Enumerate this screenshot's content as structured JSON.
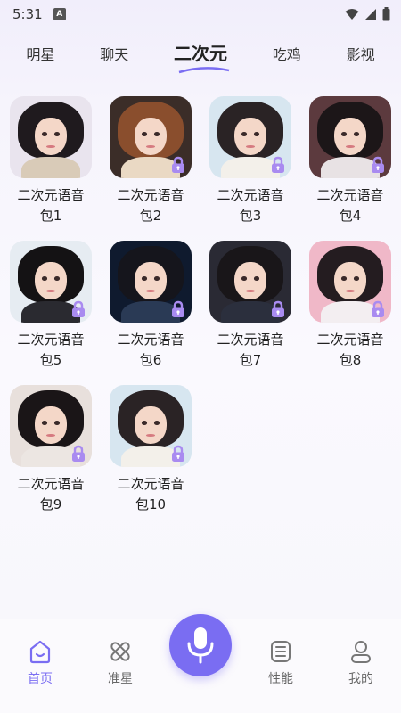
{
  "status_bar": {
    "time": "5:31",
    "app_icon_letter": "A",
    "icons": [
      "wifi-icon",
      "signal-icon",
      "battery-icon"
    ]
  },
  "tabs": [
    {
      "label": "明星",
      "active": false
    },
    {
      "label": "聊天",
      "active": false
    },
    {
      "label": "二次元",
      "active": true
    },
    {
      "label": "吃鸡",
      "active": false
    },
    {
      "label": "影视",
      "active": false
    }
  ],
  "voice_packs": [
    {
      "line1": "二次元语音",
      "line2": "包1",
      "locked": false
    },
    {
      "line1": "二次元语音",
      "line2": "包2",
      "locked": true
    },
    {
      "line1": "二次元语音",
      "line2": "包3",
      "locked": true
    },
    {
      "line1": "二次元语音",
      "line2": "包4",
      "locked": true
    },
    {
      "line1": "二次元语音",
      "line2": "包5",
      "locked": true
    },
    {
      "line1": "二次元语音",
      "line2": "包6",
      "locked": true
    },
    {
      "line1": "二次元语音",
      "line2": "包7",
      "locked": true
    },
    {
      "line1": "二次元语音",
      "line2": "包8",
      "locked": true
    },
    {
      "line1": "二次元语音",
      "line2": "包9",
      "locked": true
    },
    {
      "line1": "二次元语音",
      "line2": "包10",
      "locked": true
    }
  ],
  "bottom_nav": {
    "items": [
      {
        "label": "首页",
        "icon": "home-icon",
        "active": true
      },
      {
        "label": "准星",
        "icon": "crosshair-icon",
        "active": false
      },
      {
        "label": "性能",
        "icon": "performance-icon",
        "active": false
      },
      {
        "label": "我的",
        "icon": "profile-icon",
        "active": false
      }
    ],
    "center_button_icon": "microphone-icon"
  },
  "colors": {
    "accent": "#7a6df2",
    "lock": "#a98bf0",
    "text": "#222222"
  }
}
